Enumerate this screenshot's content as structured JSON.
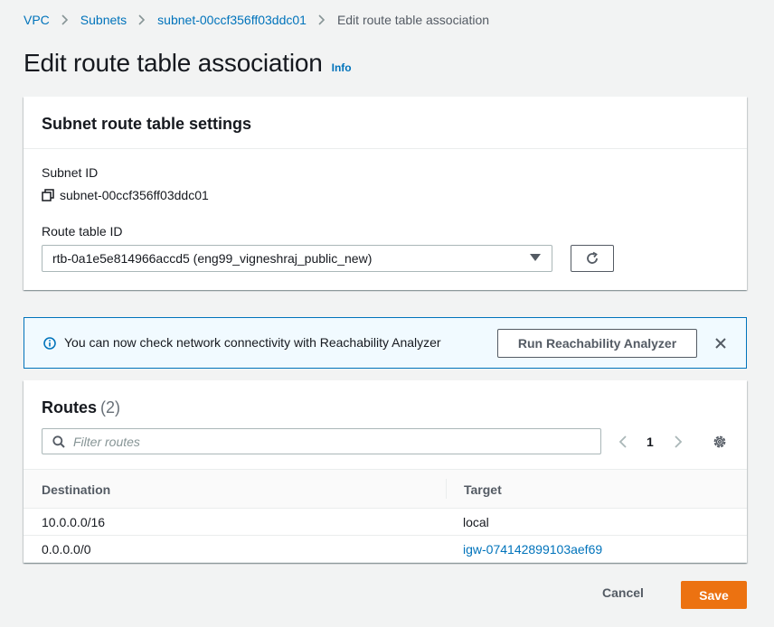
{
  "breadcrumb": {
    "items": [
      "VPC",
      "Subnets",
      "subnet-00ccf356ff03ddc01"
    ],
    "current": "Edit route table association"
  },
  "page": {
    "title": "Edit route table association",
    "info": "Info"
  },
  "settings": {
    "title": "Subnet route table settings",
    "subnet_id_label": "Subnet ID",
    "subnet_id_value": "subnet-00ccf356ff03ddc01",
    "route_table_label": "Route table ID",
    "route_table_selected": "rtb-0a1e5e814966accd5 (eng99_vigneshraj_public_new)"
  },
  "alert": {
    "message": "You can now check network connectivity with Reachability Analyzer",
    "button_label": "Run Reachability Analyzer"
  },
  "routes": {
    "title": "Routes",
    "count": "(2)",
    "filter_placeholder": "Filter routes",
    "page_number": "1",
    "columns": [
      "Destination",
      "Target"
    ],
    "rows": [
      {
        "destination": "10.0.0.0/16",
        "target": "local",
        "target_is_link": false
      },
      {
        "destination": "0.0.0.0/0",
        "target": "igw-074142899103aef69",
        "target_is_link": true
      }
    ]
  },
  "footer": {
    "cancel_label": "Cancel",
    "save_label": "Save"
  },
  "colors": {
    "link": "#0073bb",
    "primary_button": "#ec7211",
    "alert_background": "#f1faff",
    "alert_border": "#0073bb"
  }
}
